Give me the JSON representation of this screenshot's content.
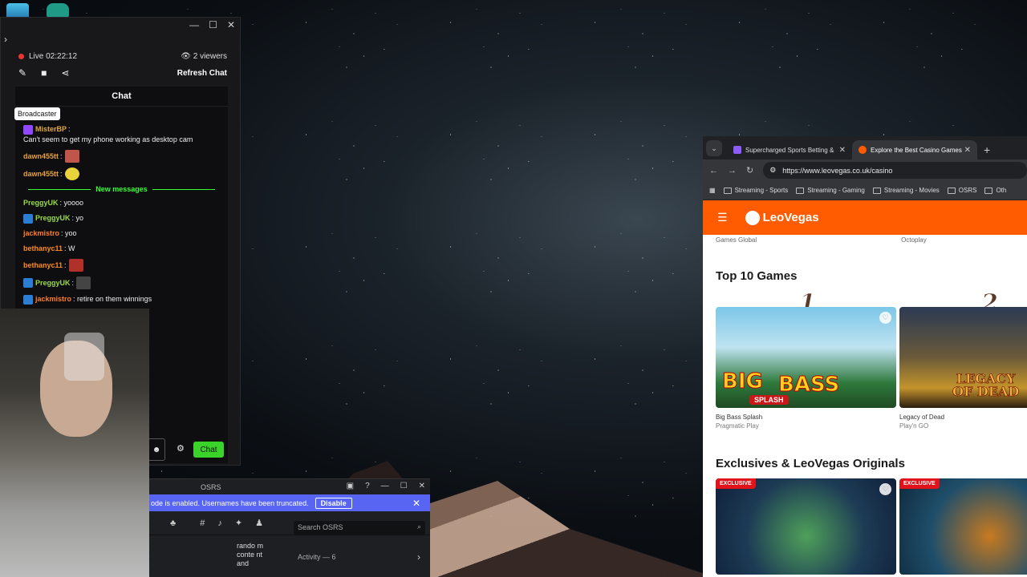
{
  "chat_window": {
    "live_status": "Live 02:22:12",
    "viewers": "2 viewers",
    "refresh_label": "Refresh Chat",
    "chat_title": "Chat",
    "tooltip": "Broadcaster",
    "new_messages_label": "New messages",
    "chat_button": "Chat",
    "messages": [
      {
        "user": "MisterBP",
        "text": "Can't seem to get my phone working as desktop cam",
        "color": "#e0a83b"
      },
      {
        "user": "dawn455tt",
        "text": "",
        "color": "#e6a23c"
      },
      {
        "user": "dawn455tt",
        "text": "",
        "color": "#e6a23c"
      },
      {
        "user": "PreggyUK",
        "text": "yoooo",
        "color": "#9ad94a"
      },
      {
        "user": "PreggyUK",
        "text": "yo",
        "color": "#9ad94a"
      },
      {
        "user": "jackmistro",
        "text": "yoo",
        "color": "#ff7f2a"
      },
      {
        "user": "bethanyc11",
        "text": "W",
        "color": "#ff8c1a"
      },
      {
        "user": "bethanyc11",
        "text": "",
        "color": "#ff8c1a"
      },
      {
        "user": "PreggyUK",
        "text": "",
        "color": "#9ad94a"
      },
      {
        "user": "jackmistro",
        "text": "retire on them winnings",
        "color": "#ff7f2a"
      }
    ]
  },
  "osrs_window": {
    "title": "OSRS",
    "banner_text": "ode is enabled. Usernames have been truncated.",
    "disable_label": "Disable",
    "search_placeholder": "Search OSRS",
    "side_text": "rando m conte nt and",
    "activity_label": "Activity — 6"
  },
  "browser": {
    "tabs": [
      {
        "label": "Supercharged Sports Betting &",
        "active": false
      },
      {
        "label": "Explore the Best Casino Games",
        "active": true
      }
    ],
    "url": "https://www.leovegas.co.uk/casino",
    "bookmarks": [
      "Streaming - Sports",
      "Streaming - Gaming",
      "Streaming - Movies",
      "OSRS",
      "Oth"
    ],
    "brand": "LeoVegas",
    "brand_color": "#ff5b00",
    "providers_top": [
      "Games Global",
      "Octoplay"
    ],
    "section_top10": "Top 10 Games",
    "games": [
      {
        "rank": "1",
        "name": "Big Bass Splash",
        "provider": "Pragmatic Play"
      },
      {
        "rank": "2",
        "name": "Legacy of Dead",
        "provider": "Play'n GO"
      }
    ],
    "section_exclusives": "Exclusives & LeoVegas Originals",
    "exclusive_badge": "EXCLUSIVE"
  }
}
